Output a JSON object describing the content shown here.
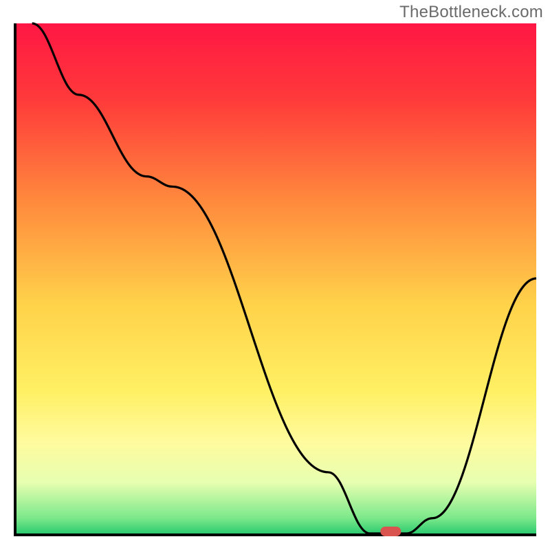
{
  "watermark": "TheBottleneck.com",
  "chart_data": {
    "type": "line",
    "title": "",
    "xlabel": "",
    "ylabel": "",
    "xlim": [
      0,
      100
    ],
    "ylim": [
      0,
      100
    ],
    "grid": false,
    "legend": false,
    "series": [
      {
        "name": "curve",
        "x": [
          3,
          12,
          25,
          30,
          60,
          68,
          75,
          80,
          100
        ],
        "y": [
          100,
          86,
          70,
          68,
          12,
          0,
          0,
          3,
          50
        ]
      }
    ],
    "marker": {
      "x": 72,
      "y": 0,
      "color": "#d9534f"
    },
    "background_gradient": {
      "stops": [
        {
          "offset": 0.0,
          "color": "#ff1744"
        },
        {
          "offset": 0.15,
          "color": "#ff3a3a"
        },
        {
          "offset": 0.35,
          "color": "#ff8a3d"
        },
        {
          "offset": 0.55,
          "color": "#ffd24a"
        },
        {
          "offset": 0.72,
          "color": "#fff063"
        },
        {
          "offset": 0.82,
          "color": "#fffb9e"
        },
        {
          "offset": 0.9,
          "color": "#e6ffb0"
        },
        {
          "offset": 0.97,
          "color": "#7be88a"
        },
        {
          "offset": 1.0,
          "color": "#2ecc71"
        }
      ]
    }
  }
}
